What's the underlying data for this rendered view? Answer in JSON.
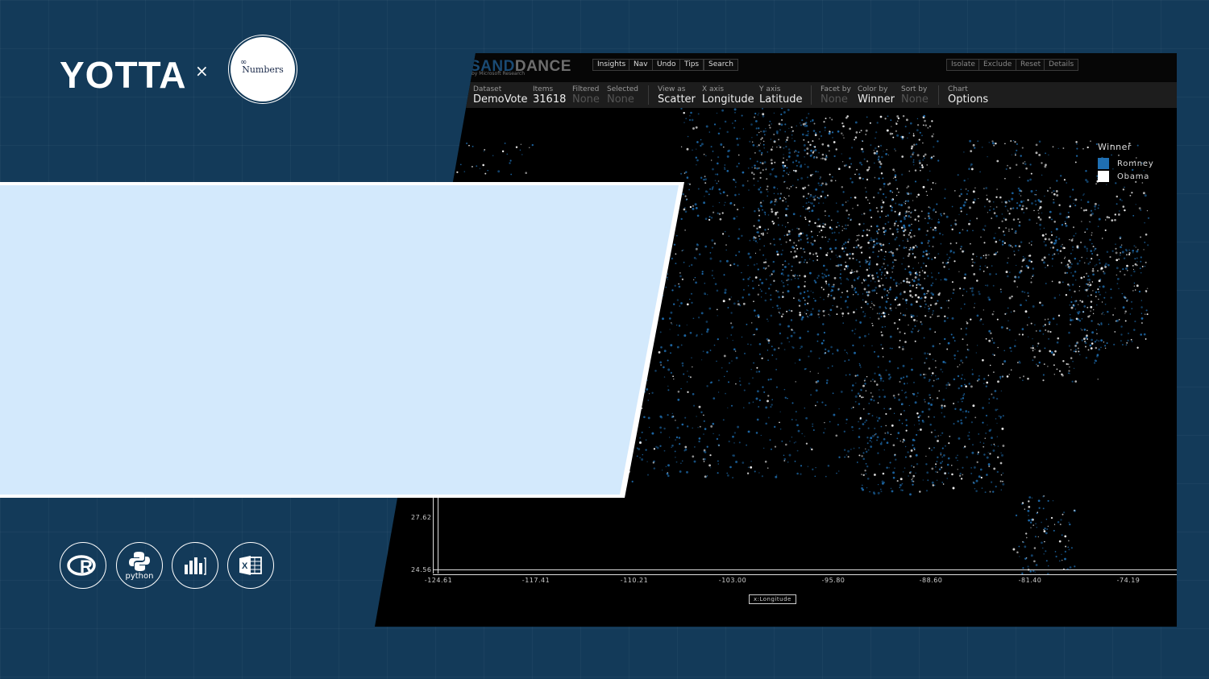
{
  "brand": {
    "logo_text": "YOTTA",
    "separator": "×",
    "partner_name": "Numbers",
    "partner_mark": "∞"
  },
  "sanddance": {
    "logo_part1": "SAND",
    "logo_part2": "DANCE",
    "logo_sub": "by Microsoft Research",
    "top_buttons": [
      "Insights",
      "Nav",
      "Undo",
      "Tips",
      "Search"
    ],
    "right_buttons": [
      "Isolate",
      "Exclude",
      "Reset",
      "Details"
    ],
    "toolbar": [
      {
        "label": "Dataset",
        "value": "DemoVote"
      },
      {
        "label": "Items",
        "value": "31618"
      },
      {
        "label": "Filtered",
        "value": "None"
      },
      {
        "label": "Selected",
        "value": "None"
      },
      {
        "label": "View as",
        "value": "Scatter"
      },
      {
        "label": "X axis",
        "value": "Longitude"
      },
      {
        "label": "Y axis",
        "value": "Latitude"
      },
      {
        "label": "Facet by",
        "value": "None"
      },
      {
        "label": "Color by",
        "value": "Winner"
      },
      {
        "label": "Sort by",
        "value": "None"
      },
      {
        "label": "Chart",
        "value": "Options"
      }
    ],
    "legend": {
      "title": "Winner",
      "items": [
        {
          "label": "Romney",
          "color": "#1f6fb2"
        },
        {
          "label": "Obama",
          "color": "#ffffff"
        }
      ]
    },
    "y_ticks": [
      "27.62",
      "24.56"
    ],
    "x_ticks": [
      "-124.61",
      "-117.41",
      "-110.21",
      "-103.00",
      "-95.80",
      "-88.60",
      "-81.40",
      "-74.19"
    ],
    "x_axis_chip": "x:Longitude"
  },
  "tools": {
    "r": "R",
    "python": "python",
    "powerbi": "",
    "excel": "X"
  },
  "colors": {
    "background": "#133a59",
    "banner": "#d3e9fc",
    "romney": "#1f6fb2",
    "obama": "#ffffff"
  }
}
